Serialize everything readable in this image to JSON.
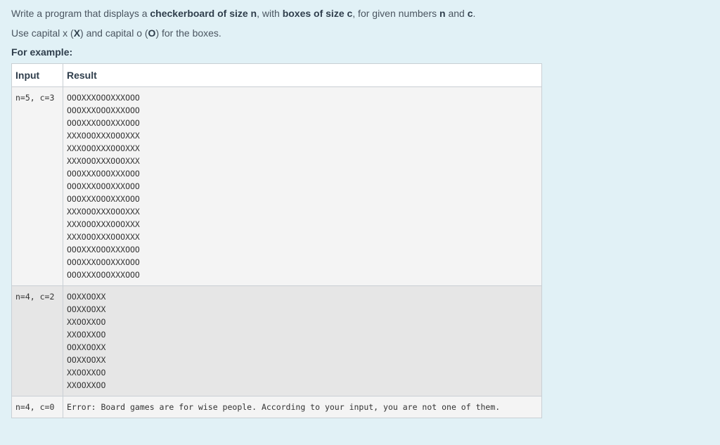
{
  "instructions": {
    "line1_parts": [
      {
        "text": "Write a program that displays a ",
        "bold": false
      },
      {
        "text": "checkerboard of size n",
        "bold": true
      },
      {
        "text": ", with ",
        "bold": false
      },
      {
        "text": "boxes of size c",
        "bold": true
      },
      {
        "text": ", for given numbers ",
        "bold": false
      },
      {
        "text": "n",
        "bold": true
      },
      {
        "text": " and ",
        "bold": false
      },
      {
        "text": "c",
        "bold": true
      },
      {
        "text": ".",
        "bold": false
      }
    ],
    "line2_parts": [
      {
        "text": "Use capital x (",
        "bold": false
      },
      {
        "text": "X",
        "bold": true
      },
      {
        "text": ") and capital o (",
        "bold": false
      },
      {
        "text": "O",
        "bold": true
      },
      {
        "text": ") for the boxes.",
        "bold": false
      }
    ],
    "for_example": "For example:"
  },
  "table": {
    "headers": {
      "input": "Input",
      "result": "Result"
    },
    "rows": [
      {
        "input": "n=5, c=3",
        "result": "OOOXXXOOOXXXOOO\nOOOXXXOOOXXXOOO\nOOOXXXOOOXXXOOO\nXXXOOOXXXOOOXXX\nXXXOOOXXXOOOXXX\nXXXOOOXXXOOOXXX\nOOOXXXOOOXXXOOO\nOOOXXXOOOXXXOOO\nOOOXXXOOOXXXOOO\nXXXOOOXXXOOOXXX\nXXXOOOXXXOOOXXX\nXXXOOOXXXOOOXXX\nOOOXXXOOOXXXOOO\nOOOXXXOOOXXXOOO\nOOOXXXOOOXXXOOO"
      },
      {
        "input": "n=4, c=2",
        "result": "OOXXOOXX\nOOXXOOXX\nXXOOXXOO\nXXOOXXOO\nOOXXOOXX\nOOXXOOXX\nXXOOXXOO\nXXOOXXOO"
      },
      {
        "input": "n=4, c=0",
        "result": "Error: Board games are for wise people. According to your input, you are not one of them."
      }
    ]
  },
  "colors": {
    "background": "#e1f1f6",
    "row_light": "#f4f4f4",
    "row_dark": "#e6e6e6",
    "border": "#c9cfd4"
  }
}
